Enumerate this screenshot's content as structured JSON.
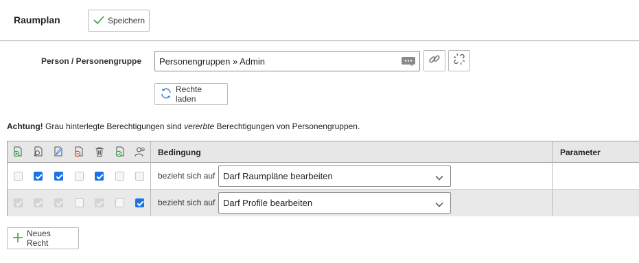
{
  "header": {
    "title": "Raumplan",
    "save_label": "Speichern"
  },
  "person": {
    "label": "Person / Personengruppe",
    "value": "Personengruppen » Admin",
    "load_rights_label": "Rechte laden"
  },
  "notice": {
    "prefix": "Achtung!",
    "text_before": " Grau hinterlegte Berechtigungen sind ",
    "emphasis": "vererbte",
    "text_after": " Berechtigungen von Personengruppen."
  },
  "table": {
    "header_icons": [
      "add-doc-icon",
      "search-doc-icon",
      "edit-doc-icon",
      "remove-doc-icon",
      "trash-icon",
      "approve-doc-icon",
      "user-settings-icon"
    ],
    "col_condition": "Bedingung",
    "col_parameter": "Parameter",
    "rows": [
      {
        "checks": [
          false,
          true,
          true,
          false,
          true,
          false,
          false
        ],
        "inherited": [
          false,
          false,
          false,
          false,
          false,
          false,
          false
        ],
        "relates_label": "bezieht sich auf",
        "selected": "Darf Raumpläne bearbeiten"
      },
      {
        "checks": [
          true,
          true,
          true,
          false,
          true,
          false,
          true
        ],
        "inherited": [
          true,
          true,
          true,
          false,
          true,
          false,
          false
        ],
        "relates_label": "bezieht sich auf",
        "selected": "Darf Profile bearbeiten"
      }
    ]
  },
  "footer": {
    "new_right_label": "Neues Recht"
  },
  "colors": {
    "accent": "#1a73e8",
    "success": "#2e9e3e"
  }
}
